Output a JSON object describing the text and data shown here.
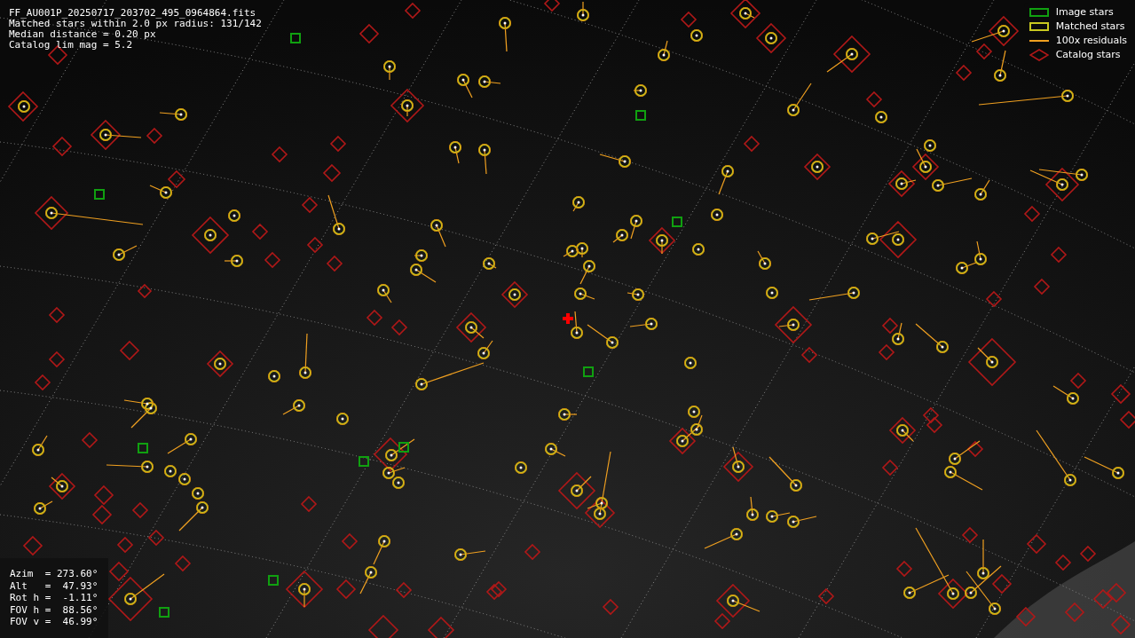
{
  "info_lines": [
    "FF_AU001P_20250717_203702_495_0964864.fits",
    "Matched stars within 2.0 px radius: 131/142",
    "Median distance = 0.20 px",
    "Catalog lim mag = 5.2"
  ],
  "legend": [
    {
      "kind": "image",
      "label": "Image stars"
    },
    {
      "kind": "matched",
      "label": "Matched stars"
    },
    {
      "kind": "residual",
      "label": "100x residuals"
    },
    {
      "kind": "catalog",
      "label": "Catalog stars"
    }
  ],
  "pointing": [
    "Azim  = 273.60°",
    "Alt   =  47.93°",
    "Rot h =  -1.11°",
    "FOV h =  88.56°",
    "FOV v =  46.99°"
  ]
}
